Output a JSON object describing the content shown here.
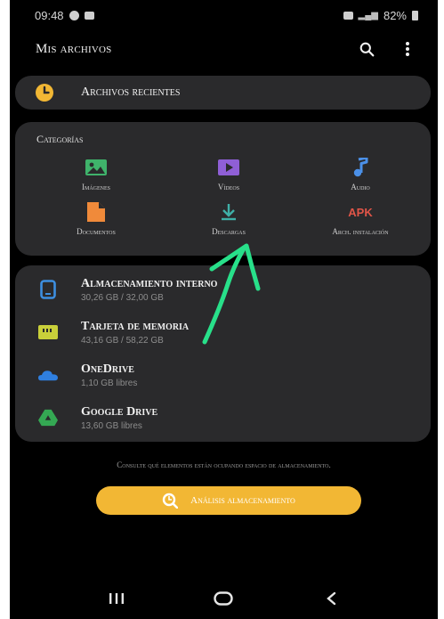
{
  "status": {
    "time": "09:48",
    "battery": "82%"
  },
  "app_bar": {
    "title": "Mis archivos"
  },
  "recent": {
    "label": "Archivos recientes"
  },
  "categories": {
    "title": "Categorías",
    "items": [
      {
        "label": "Imágenes",
        "icon": "image-icon",
        "color": "#3fb36b"
      },
      {
        "label": "Vídeos",
        "icon": "video-icon",
        "color": "#8f5fd6"
      },
      {
        "label": "Audio",
        "icon": "audio-icon",
        "color": "#4b90e8"
      },
      {
        "label": "Documentos",
        "icon": "document-icon",
        "color": "#f08a3a"
      },
      {
        "label": "Descargas",
        "icon": "download-icon",
        "color": "#3fb0a8"
      },
      {
        "label": "Arch. instalación",
        "icon_text": "APK",
        "color": "#e05548"
      }
    ]
  },
  "storage": [
    {
      "name": "Almacenamiento interno",
      "detail": "30,26 GB / 32,00 GB",
      "icon": "phone-storage-icon",
      "color": "#3d8fe0"
    },
    {
      "name": "Tarjeta de memoria",
      "detail": "43,16 GB / 58,22 GB",
      "icon": "sd-card-icon",
      "color": "#c9d03a"
    },
    {
      "name": "OneDrive",
      "detail": "1,10 GB libres",
      "icon": "onedrive-icon",
      "color": "#2f7fe0"
    },
    {
      "name": "Google Drive",
      "detail": "13,60 GB libres",
      "icon": "google-drive-icon",
      "color": "#34a853"
    }
  ],
  "hint": "Consulte qué elementos están ocupando espacio de almacenamiento.",
  "analyze_button": {
    "label": "Análisis almacenamiento",
    "color": "#f2b734"
  },
  "annotation": {
    "color": "#28e08a"
  }
}
